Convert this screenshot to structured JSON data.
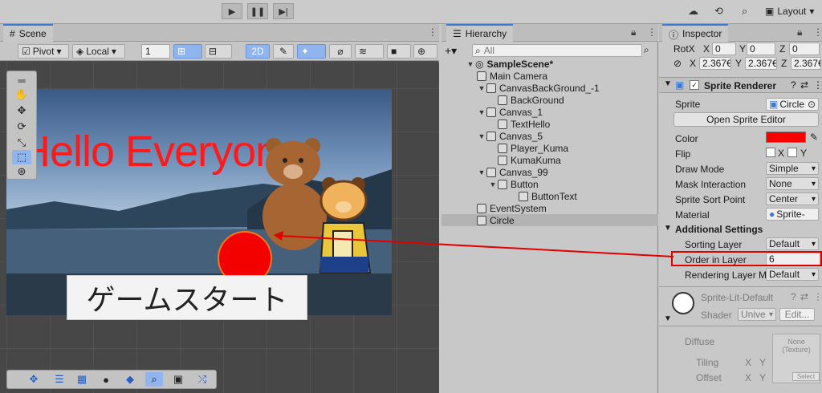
{
  "toolbar": {
    "layout_label": "Layout"
  },
  "scene": {
    "tab_label": "Scene",
    "pivot_label": "Pivot",
    "local_label": "Local",
    "grid_value": "1",
    "mode_2d": "2D",
    "hello_text": "Hello Everyone",
    "start_button": "ゲームスタート"
  },
  "hierarchy": {
    "tab_label": "Hierarchy",
    "search_placeholder": "All",
    "items": [
      {
        "label": "SampleScene*",
        "bold": true
      },
      {
        "label": "Main Camera"
      },
      {
        "label": "CanvasBackGround_-1"
      },
      {
        "label": "BackGround"
      },
      {
        "label": "Canvas_1"
      },
      {
        "label": "TextHello"
      },
      {
        "label": "Canvas_5"
      },
      {
        "label": "Player_Kuma"
      },
      {
        "label": "KumaKuma"
      },
      {
        "label": "Canvas_99"
      },
      {
        "label": "Button"
      },
      {
        "label": "ButtonText"
      },
      {
        "label": "EventSystem"
      },
      {
        "label": "Circle",
        "selected": true
      }
    ]
  },
  "inspector": {
    "tab_label": "Inspector",
    "rotx_label": "RotX",
    "x_label": "X",
    "y_label": "Y",
    "z_label": "Z",
    "rot": {
      "x": "0",
      "y": "0",
      "z": "0"
    },
    "scale": {
      "x": "2.367€",
      "y": "2.367€",
      "z": "2.367€"
    },
    "component_title": "Sprite Renderer",
    "sprite_label": "Sprite",
    "sprite_value": "Circle",
    "open_editor": "Open Sprite Editor",
    "color_label": "Color",
    "color_value": "#f70000",
    "flip_label": "Flip",
    "flip_x": "X",
    "flip_y": "Y",
    "draw_mode_label": "Draw Mode",
    "draw_mode_value": "Simple",
    "mask_label": "Mask Interaction",
    "mask_value": "None",
    "sort_point_label": "Sprite Sort Point",
    "sort_point_value": "Center",
    "material_label": "Material",
    "material_value": "Sprite-",
    "additional_label": "Additional Settings",
    "sorting_layer_label": "Sorting Layer",
    "sorting_layer_value": "Default",
    "order_label": "Order in Layer",
    "order_value": "6",
    "rendering_label": "Rendering Layer M",
    "rendering_value": "Default",
    "material_name": "Sprite-Lit-Default",
    "shader_label": "Shader",
    "shader_value": "Unive",
    "edit_label": "Edit...",
    "diffuse_label": "Diffuse",
    "none_texture": "None (Texture)",
    "select_label": "Select",
    "tiling_label": "Tiling",
    "offset_label": "Offset"
  },
  "colors": {
    "accent": "#3a79d9",
    "highlight": "#e10000",
    "circle": "#f30000"
  }
}
